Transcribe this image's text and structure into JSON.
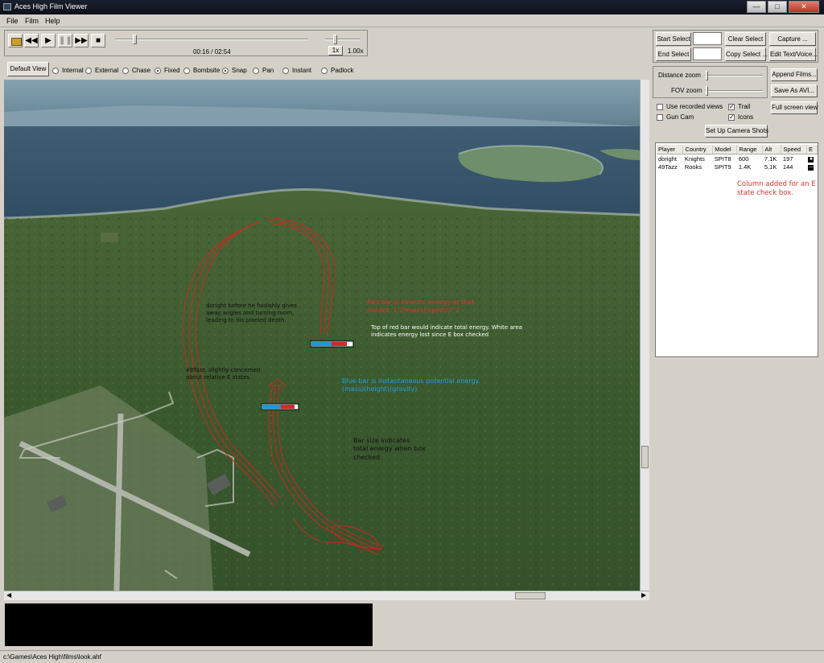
{
  "window": {
    "title": "Aces High Film Viewer"
  },
  "menu": [
    "File",
    "Film",
    "Help"
  ],
  "playback": {
    "time": "00:16 / 02:54",
    "speed_button": "1x",
    "speed_value": "1.00x",
    "progress": 0.09
  },
  "view_modes": {
    "default_label": "Default View",
    "options": [
      "Internal",
      "External",
      "Chase",
      "Fixed",
      "Bombsite",
      "Snap",
      "Pan",
      "Instant",
      "Padlock"
    ],
    "selected": [
      "Fixed",
      "Snap"
    ]
  },
  "right": {
    "start_select": "Start Select",
    "clear_select": "Clear Select",
    "capture": "Capture ...",
    "end_select": "End Select",
    "copy_select": "Copy Select ...",
    "edit_text": "Edit Text/Voice...",
    "distance_zoom": "Distance zoom",
    "fov_zoom": "FOV zoom",
    "append_films": "Append Films...",
    "save_avi": "Save As AVI...",
    "full_screen": "Full screen view",
    "use_recorded_views": "Use recorded views",
    "trail": "Trail",
    "gun_cam": "Gun Cam",
    "icons": "Icons",
    "camera_shots": "Set Up Camera Shots"
  },
  "table": {
    "headers": [
      "Player",
      "Country",
      "Model",
      "Range",
      "Alt",
      "Speed",
      "E"
    ],
    "rows": [
      [
        "doright",
        "Knights",
        "SPIT8",
        "600",
        "7.1K",
        "197"
      ],
      [
        "49Tazz",
        "Rooks",
        "SPIT9",
        "1.4K",
        "5.1K",
        "144"
      ]
    ]
  },
  "annotations": {
    "column_note": "Column added for an E state check box.",
    "doright": "doright before he foolishly gives away angles and turning room, leading to his pixeled death.",
    "tazz": "49Tazz, slightly concerned about relative E states.",
    "red_bar": "Red bar is kinectic energy at that instant. 1/2(mass)(speed)^2",
    "top_red": "Top of red bar would indicate total energy. White area indicates energy lost since E box checked",
    "blue_bar": "Blue bar is instantaneous potential energy. (mass)(height)(gravity)",
    "bar_size": "Bar size indicates total energy when box checked"
  },
  "status": {
    "path": "c:\\Games\\Aces High\\films\\look.ahf"
  },
  "colors": {
    "kinetic": "#d42a2a",
    "potential": "#1a9ad8",
    "annotation_red": "#e03030",
    "annotation_blue": "#20a0e0"
  }
}
